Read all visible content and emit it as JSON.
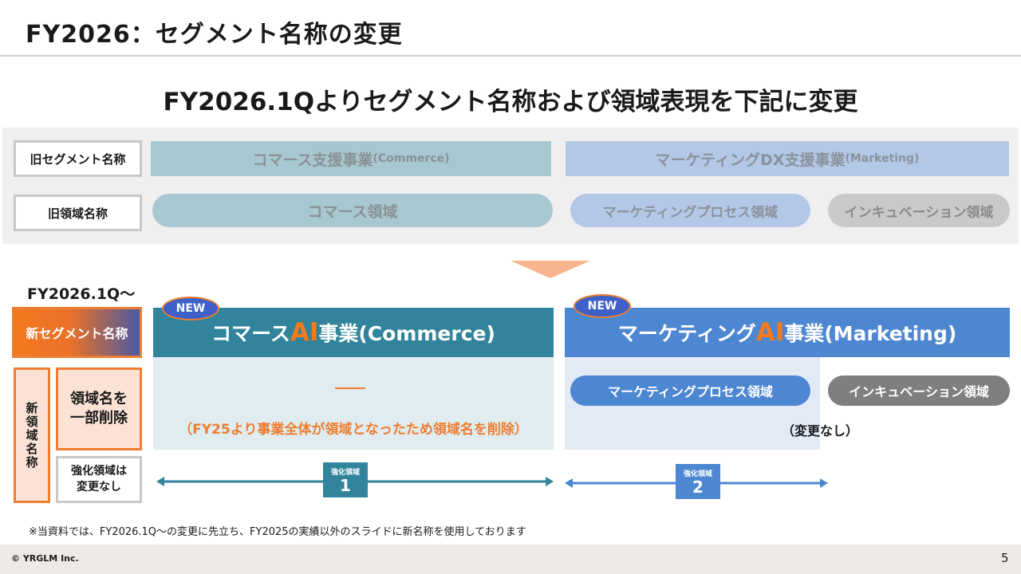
{
  "header": {
    "title": "FY2026：セグメント名称の変更"
  },
  "headline": "FY2026.1Qよりセグメント名称および領域表現を下記に変更",
  "old": {
    "segment_label": "旧セグメント名称",
    "domain_label": "旧領域名称",
    "commerce_segment": "コマース支援事業",
    "commerce_segment_en": "(Commerce)",
    "marketing_segment": "マーケティングDX支援事業",
    "marketing_segment_en": "(Marketing)",
    "commerce_domain": "コマース領域",
    "marketing_process_domain": "マーケティングプロセス領域",
    "incubation_domain": "インキュベーション領域"
  },
  "new": {
    "fy_label": "FY2026.1Q～",
    "segment_label": "新セグメント名称",
    "domain_label": "新領域名称",
    "partial_delete_label": [
      "領域名を",
      "一部削除"
    ],
    "strengthen_label": [
      "強化領域は",
      "変更なし"
    ],
    "badge": "NEW",
    "commerce": {
      "prefix": "コマース",
      "ai": "AI",
      "suffix": "事業(Commerce)"
    },
    "marketing": {
      "prefix": "マーケティング",
      "ai": "AI",
      "suffix": "事業(Marketing)"
    },
    "commerce_note": "（FY25より事業全体が領域となったため領域名を削除）",
    "marketing_process_domain": "マーケティングプロセス領域",
    "incubation_domain": "インキュベーション領域",
    "no_change_note": "（変更なし）",
    "strength_label": "強化領域",
    "strength_1": "1",
    "strength_2": "2"
  },
  "footnote": "※当資料では、FY2026.1Q～の変更に先立ち、FY2025の実績以外のスライドに新名称を使用しております",
  "footer": {
    "copyright": "© YRGLM Inc.",
    "page": "5"
  },
  "colors": {
    "accent_orange": "#ED7D31",
    "commerce_teal": "#31849B",
    "marketing_blue": "#4D87D1",
    "incubation_gray": "#7F7F7F"
  }
}
